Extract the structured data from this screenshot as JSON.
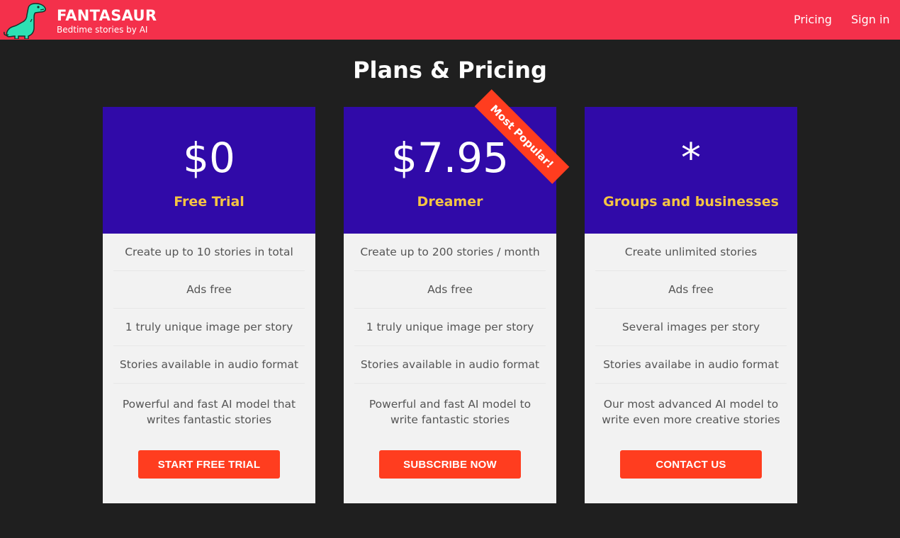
{
  "header": {
    "brand_name": "FANTASAUR",
    "tagline": "Bedtime stories by AI",
    "logo_icon": "dinosaur-icon",
    "nav": {
      "pricing": "Pricing",
      "sign_in": "Sign in"
    },
    "background_color": "#f4304b"
  },
  "page": {
    "title": "Plans & Pricing",
    "background_color": "#1f1f1f"
  },
  "ribbon": "Most Popular!",
  "plans": [
    {
      "price": "$0",
      "name": "Free Trial",
      "features": [
        "Create up to 10 stories in total",
        "Ads free",
        "1 truly unique image per story",
        "Stories available in audio format",
        "Powerful and fast AI model that writes fantastic stories"
      ],
      "cta": "START FREE TRIAL"
    },
    {
      "price": "$7.95",
      "name": "Dreamer",
      "features": [
        "Create up to 200 stories / month",
        "Ads free",
        "1 truly unique image per story",
        "Stories available in audio format",
        "Powerful and fast AI model to write fantastic stories"
      ],
      "cta": "SUBSCRIBE NOW"
    },
    {
      "price": "*",
      "name": "Groups and businesses",
      "features": [
        "Create unlimited stories",
        "Ads free",
        "Several images per story",
        "Stories availabe in audio format",
        "Our most advanced AI model to write even more creative stories"
      ],
      "cta": "CONTACT US"
    }
  ],
  "colors": {
    "card_head": "#300aa8",
    "plan_name": "#f5c542",
    "cta": "#ff3d1f",
    "card_body": "#f2f2f2"
  }
}
